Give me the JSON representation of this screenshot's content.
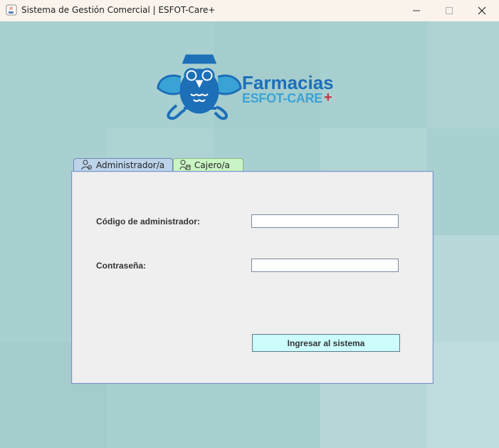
{
  "window": {
    "title": "Sistema de Gestión Comercial | ESFOT-Care+",
    "app_icon": "java-coffee-icon",
    "controls": {
      "minimize": "minimize-icon",
      "maximize": "maximize-icon",
      "close": "close-icon"
    }
  },
  "logo": {
    "line1": "Farmacias",
    "line2": "ESFOT-CARE",
    "plus": "+",
    "mascot": "owl-pharmacist-icon",
    "colors": {
      "primary": "#1d6fb8",
      "secondary": "#3aa3d6",
      "plus": "#c8324a"
    }
  },
  "tabs": [
    {
      "label": "Administrador/a",
      "icon": "admin-user-icon",
      "selected": true
    },
    {
      "label": "Cajero/a",
      "icon": "cashier-icon",
      "selected": false
    }
  ],
  "form": {
    "code_label": "Código de administrador:",
    "code_value": "",
    "password_label": "Contraseña:",
    "password_value": "",
    "submit_label": "Ingresar al sistema"
  },
  "colors": {
    "background": "#a9d0d0",
    "panel": "#efefef",
    "tab_admin": "#bcd3ea",
    "tab_cajero": "#c9f5c4",
    "button": "#ccfcfc"
  }
}
